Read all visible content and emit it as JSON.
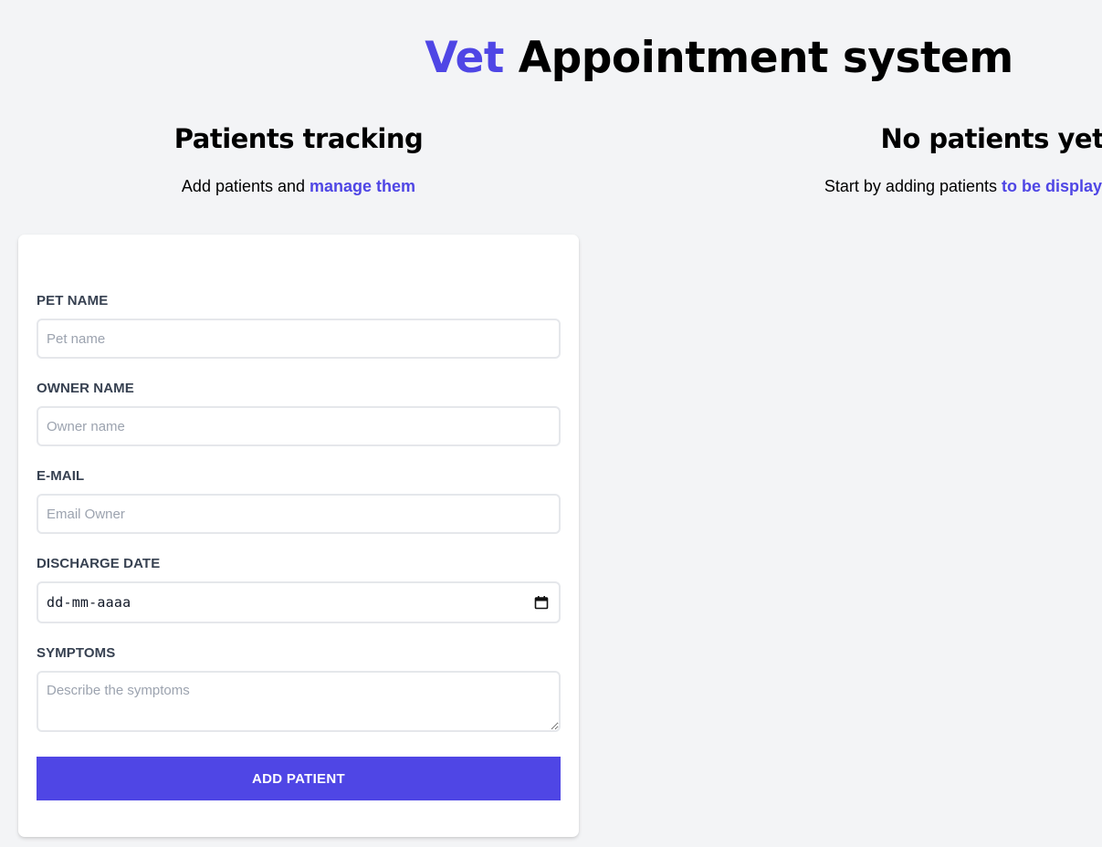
{
  "header": {
    "title_accent": "Vet",
    "title_rest": " Appointment system"
  },
  "form_section": {
    "heading": "Patients tracking",
    "subtitle_plain": "Add patients and ",
    "subtitle_accent": "manage them"
  },
  "list_section": {
    "heading": "No patients yet",
    "subtitle_plain": "Start by adding patients ",
    "subtitle_accent": "to be displayed here"
  },
  "form": {
    "pet_name": {
      "label": "PET NAME",
      "placeholder": "Pet name",
      "value": ""
    },
    "owner_name": {
      "label": "OWNER NAME",
      "placeholder": "Owner name",
      "value": ""
    },
    "email": {
      "label": "E-MAIL",
      "placeholder": "Email Owner",
      "value": ""
    },
    "discharge_date": {
      "label": "DISCHARGE DATE",
      "display": "dd-mm-aaaa",
      "icon": "calendar-icon"
    },
    "symptoms": {
      "label": "SYMPTOMS",
      "placeholder": "Describe the symptoms"
    },
    "submit_label": "ADD PATIENT"
  },
  "colors": {
    "accent": "#4f46e5",
    "background": "#f3f4f6",
    "label": "#374151",
    "placeholder": "#9ca3af"
  }
}
